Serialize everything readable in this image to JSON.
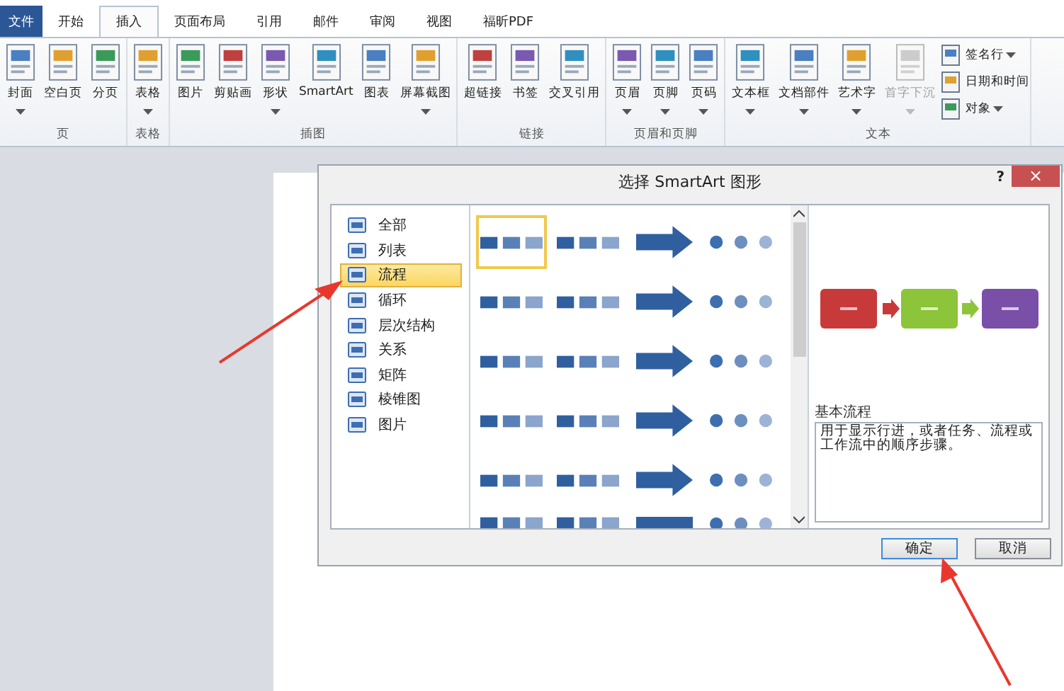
{
  "tabs": [
    {
      "label": "文件",
      "kind": "file",
      "selected": false
    },
    {
      "label": "开始",
      "kind": "tab",
      "selected": false
    },
    {
      "label": "插入",
      "kind": "tab",
      "selected": true
    },
    {
      "label": "页面布局",
      "kind": "tab",
      "selected": false
    },
    {
      "label": "引用",
      "kind": "tab",
      "selected": false
    },
    {
      "label": "邮件",
      "kind": "tab",
      "selected": false
    },
    {
      "label": "审阅",
      "kind": "tab",
      "selected": false
    },
    {
      "label": "视图",
      "kind": "tab",
      "selected": false
    },
    {
      "label": "福昕PDF",
      "kind": "tab",
      "selected": false
    }
  ],
  "ribbon_groups": [
    {
      "label": "页",
      "items": [
        {
          "label": "封面",
          "kind": "large",
          "dropdown": true,
          "disabled": false
        },
        {
          "label": "空白页",
          "kind": "large",
          "dropdown": false,
          "disabled": false
        },
        {
          "label": "分页",
          "kind": "large",
          "dropdown": false,
          "disabled": false
        }
      ]
    },
    {
      "label": "表格",
      "items": [
        {
          "label": "表格",
          "kind": "large",
          "dropdown": true,
          "disabled": false
        }
      ]
    },
    {
      "label": "插图",
      "items": [
        {
          "label": "图片",
          "kind": "large",
          "dropdown": false,
          "disabled": false
        },
        {
          "label": "剪贴画",
          "kind": "large",
          "dropdown": false,
          "disabled": false
        },
        {
          "label": "形状",
          "kind": "large",
          "dropdown": true,
          "disabled": false
        },
        {
          "label": "SmartArt",
          "kind": "large",
          "dropdown": false,
          "disabled": false
        },
        {
          "label": "图表",
          "kind": "large",
          "dropdown": false,
          "disabled": false
        },
        {
          "label": "屏幕截图",
          "kind": "large",
          "dropdown": true,
          "disabled": false
        }
      ]
    },
    {
      "label": "链接",
      "items": [
        {
          "label": "超链接",
          "kind": "large",
          "dropdown": false,
          "disabled": false
        },
        {
          "label": "书签",
          "kind": "large",
          "dropdown": false,
          "disabled": false
        },
        {
          "label": "交叉引用",
          "kind": "large",
          "dropdown": false,
          "disabled": false
        }
      ]
    },
    {
      "label": "页眉和页脚",
      "items": [
        {
          "label": "页眉",
          "kind": "large",
          "dropdown": true,
          "disabled": false
        },
        {
          "label": "页脚",
          "kind": "large",
          "dropdown": true,
          "disabled": false
        },
        {
          "label": "页码",
          "kind": "large",
          "dropdown": true,
          "disabled": false
        }
      ]
    },
    {
      "label": "文本",
      "items": [
        {
          "label": "文本框",
          "kind": "large",
          "dropdown": true,
          "disabled": false
        },
        {
          "label": "文档部件",
          "kind": "large",
          "dropdown": true,
          "disabled": false
        },
        {
          "label": "艺术字",
          "kind": "large",
          "dropdown": true,
          "disabled": false
        },
        {
          "label": "首字下沉",
          "kind": "large",
          "dropdown": true,
          "disabled": true
        },
        {
          "label": "签名行",
          "kind": "small",
          "dropdown": true,
          "disabled": false
        },
        {
          "label": "日期和时间",
          "kind": "small",
          "dropdown": false,
          "disabled": false
        },
        {
          "label": "对象",
          "kind": "small",
          "dropdown": true,
          "disabled": false
        }
      ]
    }
  ],
  "dialog": {
    "title": "选择 SmartArt 图形",
    "help": "?",
    "close": "×",
    "categories": [
      {
        "label": "全部",
        "selected": false
      },
      {
        "label": "列表",
        "selected": false
      },
      {
        "label": "流程",
        "selected": true
      },
      {
        "label": "循环",
        "selected": false
      },
      {
        "label": "层次结构",
        "selected": false
      },
      {
        "label": "关系",
        "selected": false
      },
      {
        "label": "矩阵",
        "selected": false
      },
      {
        "label": "棱锥图",
        "selected": false
      },
      {
        "label": "图片",
        "selected": false
      }
    ],
    "layouts": [
      {
        "selected": true
      },
      {
        "selected": false
      },
      {
        "selected": false
      },
      {
        "selected": false
      },
      {
        "selected": false
      },
      {
        "selected": false
      },
      {
        "selected": false
      },
      {
        "selected": false
      },
      {
        "selected": false
      },
      {
        "selected": false
      },
      {
        "selected": false
      },
      {
        "selected": false
      },
      {
        "selected": false
      },
      {
        "selected": false
      },
      {
        "selected": false
      },
      {
        "selected": false
      },
      {
        "selected": false
      },
      {
        "selected": false
      },
      {
        "selected": false
      },
      {
        "selected": false
      },
      {
        "selected": false
      },
      {
        "selected": false
      },
      {
        "selected": false
      },
      {
        "selected": false
      }
    ],
    "preview_name": "基本流程",
    "preview_description": "用于显示行进，或者任务、流程或工作流中的顺序步骤。",
    "buttons": [
      {
        "label": "确定",
        "kind": "default"
      },
      {
        "label": "取消",
        "kind": "normal"
      }
    ]
  }
}
